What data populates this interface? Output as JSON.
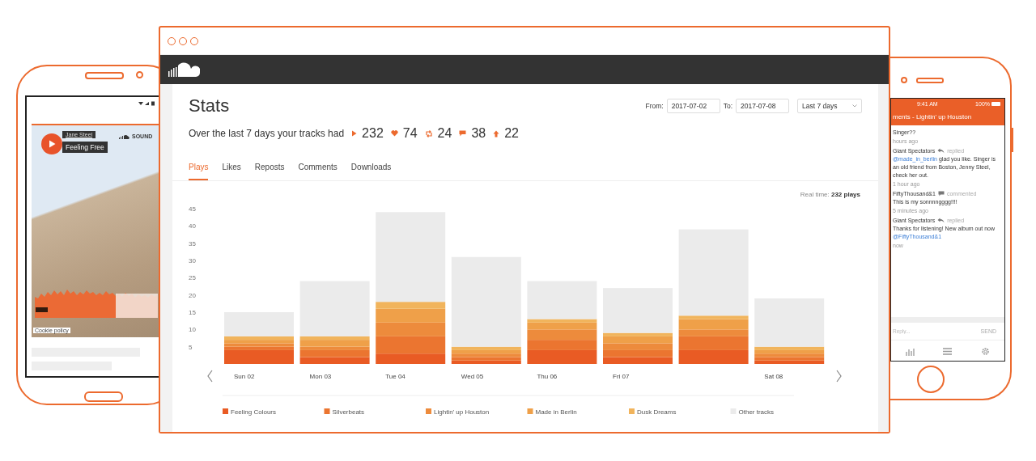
{
  "left_phone": {
    "artist": "Jane Steel",
    "track": "Feeling Free",
    "brand": "SOUND",
    "footer_link": "Cookie policy"
  },
  "browser": {
    "page_title": "Stats",
    "from_label": "From:",
    "from_value": "2017-07-02",
    "to_label": "To:",
    "to_value": "2017-07-08",
    "range": "Last 7 days",
    "summary": {
      "text": "Over the last 7 days your tracks had",
      "counts": [
        {
          "kind": "plays",
          "value": "232"
        },
        {
          "kind": "likes",
          "value": "74"
        },
        {
          "kind": "reposts",
          "value": "24"
        },
        {
          "kind": "comments",
          "value": "38"
        },
        {
          "kind": "downloads",
          "value": "22"
        }
      ]
    },
    "tabs": [
      {
        "label": "Plays",
        "selected": true
      },
      {
        "label": "Likes",
        "selected": false
      },
      {
        "label": "Reposts",
        "selected": false
      },
      {
        "label": "Comments",
        "selected": false
      },
      {
        "label": "Downloads",
        "selected": false
      }
    ],
    "realtime": "Real time: **232 plays**",
    "chart_data": {
      "type": "bar",
      "stacked": true,
      "categories": [
        "Sun 02",
        "Mon 03",
        "Tue 04",
        "Wed 05",
        "Thu 06",
        "Fri 07",
        null,
        "Sat 08"
      ],
      "ylim": [
        0,
        45
      ],
      "yticks": [
        5,
        10,
        15,
        20,
        25,
        30,
        35,
        40,
        45
      ],
      "legend": "bottom",
      "series": [
        {
          "name": "Feeling Colours",
          "color": "#e95b24",
          "values": [
            4,
            2,
            3,
            1,
            4,
            2,
            4,
            1
          ]
        },
        {
          "name": "Silverbeats",
          "color": "#eb7530",
          "values": [
            1,
            2,
            5,
            1,
            3,
            2,
            4,
            1
          ]
        },
        {
          "name": "Lightin' up Houston",
          "color": "#ed8b3c",
          "values": [
            1,
            1,
            4,
            1,
            3,
            2,
            2,
            1
          ]
        },
        {
          "name": "Made in Berlin",
          "color": "#efa049",
          "values": [
            1,
            2,
            4,
            1,
            2,
            2,
            3,
            1
          ]
        },
        {
          "name": "Dusk Dreams",
          "color": "#f1b45c",
          "values": [
            1,
            1,
            2,
            1,
            1,
            1,
            1,
            1
          ]
        },
        {
          "name": "Other tracks",
          "color": "#ebebeb",
          "values": [
            7,
            16,
            26,
            26,
            11,
            13,
            25,
            14
          ]
        }
      ]
    }
  },
  "right_phone": {
    "time": "9:41 AM",
    "battery": "100%",
    "header": "ments - Lightin' up Houston",
    "comments": [
      {
        "body": "Singer??",
        "time": "hours ago"
      },
      {
        "user": "Giant Spectators",
        "kind": "reply",
        "action": "replied",
        "mention_before": "@made_in_berlin",
        "body": "glad you like. Singer is an old friend from Boston, Jenny Steel, check her out.",
        "time": "1 hour ago"
      },
      {
        "user": "FiftyThousand&1",
        "kind": "comment",
        "action": "commented",
        "body": "This is my sonnnngggg!!!!",
        "time": "5 minutes ago"
      },
      {
        "user": "Giant Spectators",
        "kind": "reply",
        "action": "replied",
        "body": "Thanks for listening! New album out now",
        "mention_after": "@FiftyThousand&1",
        "time": "now"
      }
    ],
    "reply_placeholder": "Reply...",
    "send": "SEND"
  }
}
